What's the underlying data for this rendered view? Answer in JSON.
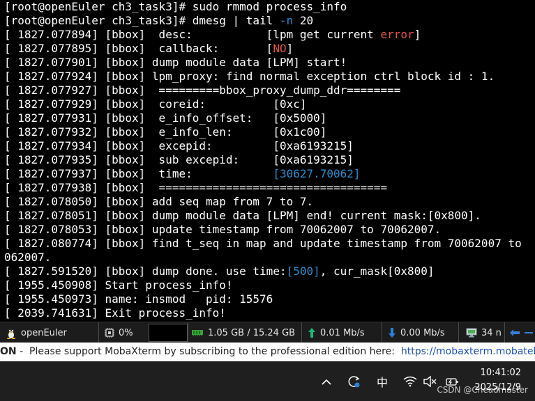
{
  "terminal": {
    "lines": [
      [
        {
          "t": "[root@openEuler ch3_task3]# sudo rmmod process_info"
        }
      ],
      [
        {
          "t": "[root@openEuler ch3_task3]# dmesg | tail "
        },
        {
          "t": "-n",
          "c": "cyan"
        },
        {
          "t": " 20"
        }
      ],
      [
        {
          "t": "[ 1827.077894] [bbox]  desc:           [lpm get current "
        },
        {
          "t": "error",
          "c": "red"
        },
        {
          "t": "]"
        }
      ],
      [
        {
          "t": "[ 1827.077895] [bbox]  callback:       ["
        },
        {
          "t": "NO",
          "c": "red"
        },
        {
          "t": "]"
        }
      ],
      [
        {
          "t": "[ 1827.077901] [bbox] dump module data [LPM] start!"
        }
      ],
      [
        {
          "t": "[ 1827.077924] [bbox] lpm_proxy: find normal exception ctrl block id : 1."
        }
      ],
      [
        {
          "t": "[ 1827.077927] [bbox]  =========bbox_proxy_dump_ddr========"
        }
      ],
      [
        {
          "t": "[ 1827.077929] [bbox]  coreid:          [0xc]"
        }
      ],
      [
        {
          "t": "[ 1827.077931] [bbox]  e_info_offset:   [0x5000]"
        }
      ],
      [
        {
          "t": "[ 1827.077932] [bbox]  e_info_len:      [0x1c00]"
        }
      ],
      [
        {
          "t": "[ 1827.077934] [bbox]  excepid:         [0xa6193215]"
        }
      ],
      [
        {
          "t": "[ 1827.077935] [bbox]  sub excepid:     [0xa6193215]"
        }
      ],
      [
        {
          "t": "[ 1827.077937] [bbox]  time:            "
        },
        {
          "t": "[30627.70062]",
          "c": "cyan"
        }
      ],
      [
        {
          "t": "[ 1827.077938] [bbox]  =================================="
        }
      ],
      [
        {
          "t": "[ 1827.078050] [bbox] add seq map from 7 to 7."
        }
      ],
      [
        {
          "t": "[ 1827.078051] [bbox] dump module data [LPM] end! current mask:[0x800]."
        }
      ],
      [
        {
          "t": "[ 1827.078053] [bbox] update timestamp from 70062007 to 70062007."
        }
      ],
      [
        {
          "t": "[ 1827.080774] [bbox] find t_seq in map and update timestamp from 70062007 to"
        }
      ],
      [
        {
          "t": "062007."
        }
      ],
      [
        {
          "t": "[ 1827.591520] [bbox] dump done. use time:"
        },
        {
          "t": "[500]",
          "c": "cyan"
        },
        {
          "t": ", cur_mask[0x800]"
        }
      ],
      [
        {
          "t": "[ 1955.450908] Start process_info!"
        }
      ],
      [
        {
          "t": "[ 1955.450973] name: insmod   pid: 15576"
        }
      ],
      [
        {
          "t": "[ 2039.741631] Exit process_info!"
        }
      ]
    ]
  },
  "statusbar": {
    "os_name": "openEuler",
    "cpu": "0%",
    "memory": "1.05 GB / 15.24 GB",
    "upload": "0.01 Mb/s",
    "download": "0.00 Mb/s",
    "ping": "34 n"
  },
  "banner": {
    "brand": "ON",
    "sep": " - ",
    "message": "Please support MobaXterm by subscribing to the professional edition here:",
    "link": "https://mobaxterm.mobatek.net"
  },
  "taskbar": {
    "input_method": "中",
    "time": "10:41:02",
    "date": "2025/12/9",
    "watermark": "CSDN @Cheadmaster"
  },
  "colors": {
    "error_red": "#e8524a",
    "number_cyan": "#2c8fd1",
    "link_blue": "#1a4fb3"
  },
  "icons": [
    "linux-tux-icon",
    "cpu-icon",
    "memory-chip-icon",
    "upload-arrow-icon",
    "download-arrow-icon",
    "monitor-icon",
    "arrow-left-icon",
    "chevron-up-icon",
    "sync-icon",
    "wifi-icon",
    "speaker-muted-icon",
    "battery-icon"
  ]
}
